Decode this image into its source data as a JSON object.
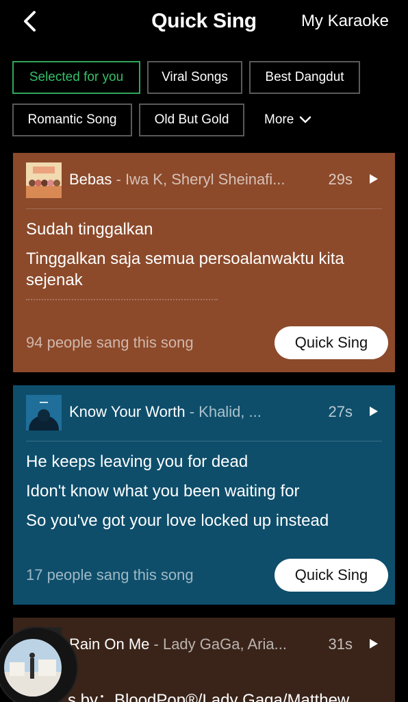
{
  "header": {
    "title": "Quick Sing",
    "right_link": "My Karaoke"
  },
  "chips": [
    {
      "label": "Selected for you",
      "selected": true
    },
    {
      "label": "Viral Songs",
      "selected": false
    },
    {
      "label": "Best Dangdut",
      "selected": false
    },
    {
      "label": "Romantic Song",
      "selected": false
    },
    {
      "label": "Old But Gold",
      "selected": false
    }
  ],
  "more_label": "More",
  "cards": [
    {
      "title": "Bebas",
      "artist_sep": " - ",
      "artist": "Iwa K, Sheryl Sheinafi...",
      "duration": "29s",
      "lyrics": [
        "Sudah tinggalkan",
        "Tinggalkan saja semua persoalanwaktu kita sejenak"
      ],
      "sang_count": "94 people sang this song",
      "button": "Quick Sing",
      "bg_color": "#8c4a2b"
    },
    {
      "title": "Know Your Worth",
      "artist_sep": " - ",
      "artist": "Khalid, ...",
      "duration": "27s",
      "lyrics": [
        "He keeps leaving you for dead",
        "Idon't know what you been waiting for",
        "So you've got your love locked up instead"
      ],
      "sang_count": "17 people sang this song",
      "button": "Quick Sing",
      "bg_color": "#0e4e6b"
    },
    {
      "title": "Rain On Me",
      "artist_sep": " - ",
      "artist": "Lady GaGa, Aria...",
      "duration": "31s",
      "lyrics": [
        "s by：BloodPop®/Lady Gaga/Matthew"
      ],
      "bg_color": "#3a2419"
    }
  ]
}
